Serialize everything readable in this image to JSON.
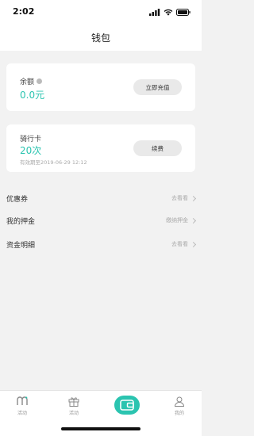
{
  "status": {
    "time": "2:02"
  },
  "header": {
    "title": "钱包"
  },
  "balance_card": {
    "label": "余额",
    "value": "0.0元",
    "button": "立即充值"
  },
  "ride_card": {
    "label": "骑行卡",
    "value": "20次",
    "expiry": "有效期至2019-06-29  12:12",
    "button": "续费"
  },
  "list": [
    {
      "label": "优惠券",
      "hint": "去看看"
    },
    {
      "label": "我的押金",
      "hint": "缴纳押金"
    },
    {
      "label": "资金明细",
      "hint": "去看看"
    }
  ],
  "tabs": [
    {
      "label": "活动",
      "icon": "m-logo-icon"
    },
    {
      "label": "活动",
      "icon": "gift-icon"
    },
    {
      "label": "",
      "icon": "wallet-icon"
    },
    {
      "label": "我的",
      "icon": "person-icon"
    }
  ],
  "colors": {
    "accent": "#2bc4b0",
    "background": "#f2f2f2"
  }
}
